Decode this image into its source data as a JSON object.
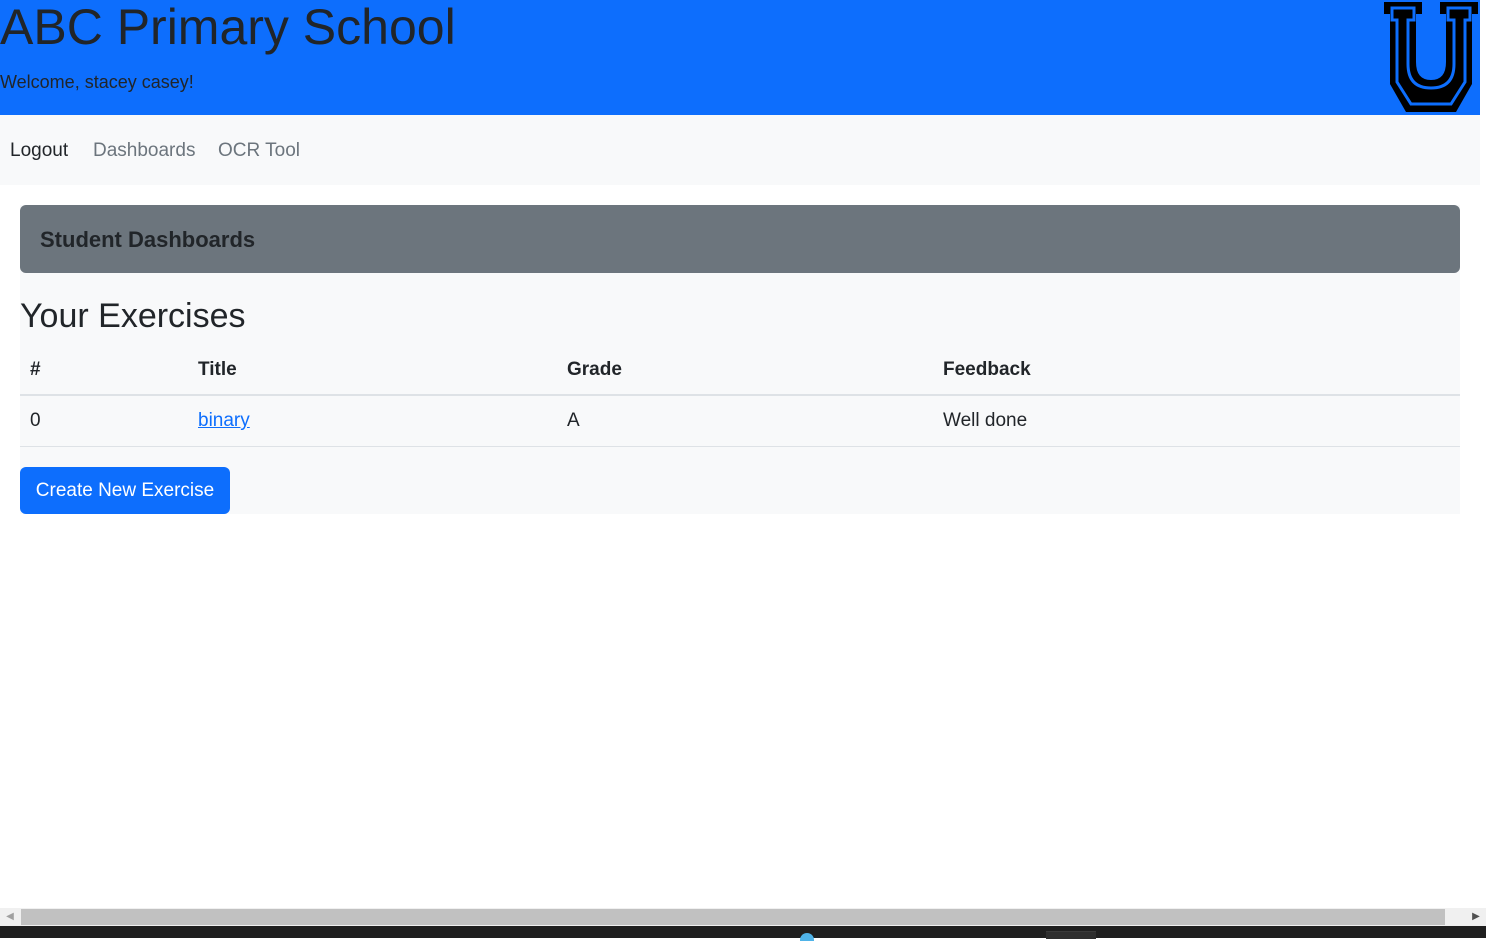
{
  "header": {
    "site_title": "ABC Primary School",
    "welcome_text": "Welcome, stacey casey!",
    "logo_icon": "block-letter-u-logo"
  },
  "nav": {
    "items": [
      {
        "label": "Logout",
        "state": "active"
      },
      {
        "label": "Dashboards",
        "state": "muted"
      },
      {
        "label": "OCR Tool",
        "state": "muted"
      }
    ]
  },
  "dashboard": {
    "card_title": "Student Dashboards",
    "section_title": "Your Exercises",
    "table": {
      "headers": [
        "#",
        "Title",
        "Grade",
        "Feedback"
      ],
      "rows": [
        {
          "num": "0",
          "title": "binary",
          "grade": "A",
          "feedback": "Well done"
        }
      ]
    },
    "create_button_label": "Create New Exercise"
  },
  "colors": {
    "primary": "#0d6efd",
    "secondary": "#6c757d",
    "light": "#f8f9fa",
    "text": "#212529"
  }
}
